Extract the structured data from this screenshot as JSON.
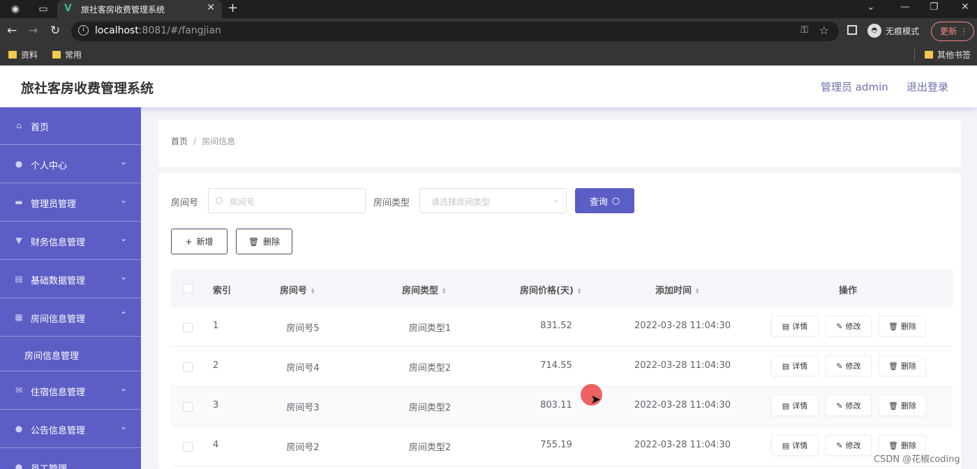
{
  "browser": {
    "tab_title": "旅社客房收费管理系统",
    "url_host": "localhost",
    "url_rest": ":8081/#/fangjian",
    "incognito_label": "无痕模式",
    "update_label": "更新",
    "bookmarks": [
      "资料",
      "常用"
    ],
    "other_bookmarks": "其他书签"
  },
  "header": {
    "title": "旅社客房收费管理系统",
    "admin": "管理员 admin",
    "logout": "退出登录"
  },
  "sidebar": {
    "items": [
      {
        "label": "首页",
        "icon": "home-icon"
      },
      {
        "label": "个人中心",
        "icon": "user-icon"
      },
      {
        "label": "管理员管理",
        "icon": "admin-icon"
      },
      {
        "label": "财务信息管理",
        "icon": "finance-icon"
      },
      {
        "label": "基础数据管理",
        "icon": "data-icon"
      },
      {
        "label": "房间信息管理",
        "icon": "grid-icon"
      },
      {
        "label": "住宿信息管理",
        "icon": "mail-icon"
      },
      {
        "label": "公告信息管理",
        "icon": "notice-icon"
      },
      {
        "label": "员工管理",
        "icon": "staff-icon"
      }
    ],
    "subitem": "房间信息管理"
  },
  "breadcrumb": {
    "home": "首页",
    "sep": "/",
    "current": "房间信息"
  },
  "search": {
    "room_no_label": "房间号",
    "room_no_placeholder": "房间号",
    "room_type_label": "房间类型",
    "room_type_placeholder": "请选择房间类型",
    "query_label": "查询"
  },
  "actions": {
    "add_label": "新增",
    "delete_label": "删除"
  },
  "table": {
    "headers": {
      "index": "索引",
      "room_no": "房间号",
      "room_type": "房间类型",
      "price": "房间价格(天)",
      "time": "添加时间",
      "ops": "操作"
    },
    "op_labels": {
      "detail": "详情",
      "edit": "修改",
      "delete": "删除"
    },
    "rows": [
      {
        "index": "1",
        "room_no": "房间号5",
        "room_type": "房间类型1",
        "price": "831.52",
        "time": "2022-03-28 11:04:30"
      },
      {
        "index": "2",
        "room_no": "房间号4",
        "room_type": "房间类型2",
        "price": "714.55",
        "time": "2022-03-28 11:04:30"
      },
      {
        "index": "3",
        "room_no": "房间号3",
        "room_type": "房间类型2",
        "price": "803.11",
        "time": "2022-03-28 11:04:30"
      },
      {
        "index": "4",
        "room_no": "房间号2",
        "room_type": "房间类型2",
        "price": "755.19",
        "time": "2022-03-28 11:04:30"
      }
    ]
  },
  "watermark": "CSDN @花椒coding",
  "colors": {
    "accent": "#5d5dc6",
    "header_link": "#6b6fae"
  }
}
